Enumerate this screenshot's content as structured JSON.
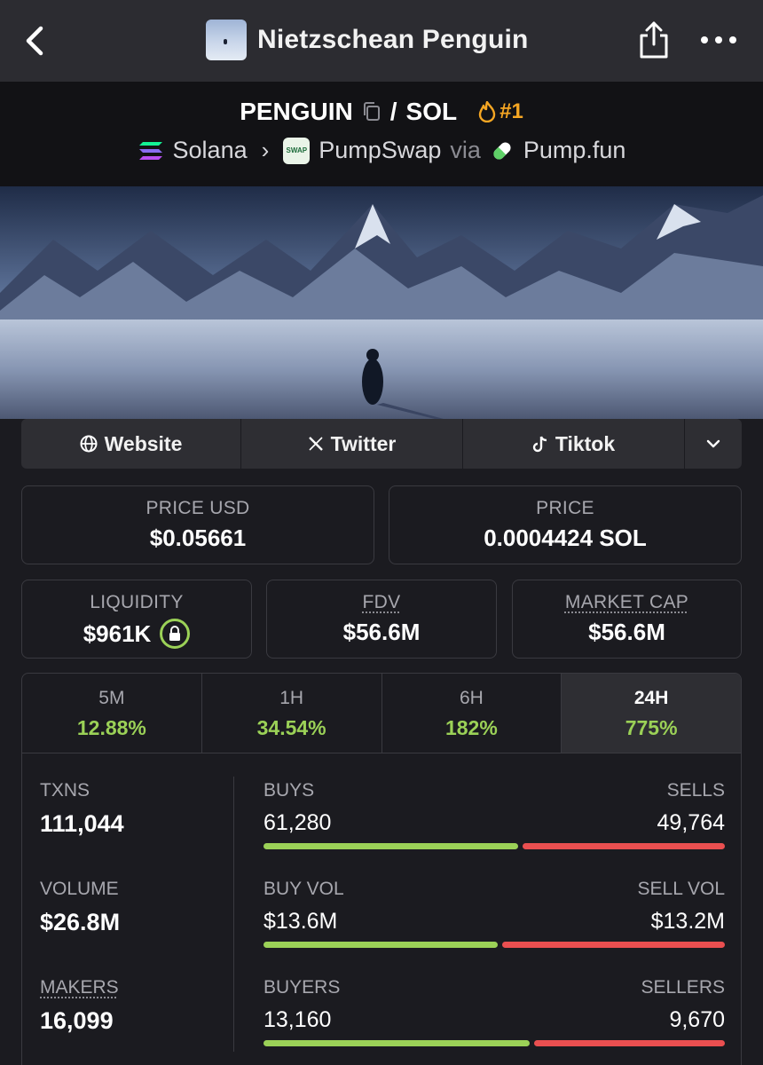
{
  "header": {
    "title": "Nietzschean Penguin"
  },
  "pair": {
    "base": "PENGUIN",
    "slash": "/",
    "quote": "SOL",
    "rank": "#1",
    "chain": "Solana",
    "dex": "PumpSwap",
    "dex_badge": "SWAP",
    "via": "via",
    "launchpad": "Pump.fun"
  },
  "links": [
    {
      "label": "Website",
      "icon": "globe-icon"
    },
    {
      "label": "Twitter",
      "icon": "x-icon"
    },
    {
      "label": "Tiktok",
      "icon": "tiktok-icon"
    }
  ],
  "stats": {
    "price_usd_label": "PRICE USD",
    "price_usd": "$0.05661",
    "price_label": "PRICE",
    "price_sol": "0.0004424 SOL",
    "liquidity_label": "LIQUIDITY",
    "liquidity": "$961K",
    "fdv_label": "FDV",
    "fdv": "$56.6M",
    "mcap_label": "MARKET CAP",
    "mcap": "$56.6M"
  },
  "timeframes": [
    {
      "label": "5M",
      "change": "12.88%"
    },
    {
      "label": "1H",
      "change": "34.54%"
    },
    {
      "label": "6H",
      "change": "182%"
    },
    {
      "label": "24H",
      "change": "775%"
    }
  ],
  "metrics": {
    "txns_label": "TXNS",
    "txns": "111,044",
    "volume_label": "VOLUME",
    "volume": "$26.8M",
    "makers_label": "MAKERS",
    "makers": "16,099",
    "buys_label": "BUYS",
    "buys": "61,280",
    "sells_label": "SELLS",
    "sells": "49,764",
    "buy_vol_label": "BUY VOL",
    "buy_vol": "$13.6M",
    "sell_vol_label": "SELL VOL",
    "sell_vol": "$13.2M",
    "buyers_label": "BUYERS",
    "buyers": "13,160",
    "sellers_label": "SELLERS",
    "sellers": "9,670",
    "buy_share_txns": 0.552,
    "buy_share_volume": 0.507,
    "buy_share_makers": 0.576
  },
  "colors": {
    "positive": "#9bd157",
    "negative": "#ea4f50",
    "rank": "#f5a623"
  }
}
